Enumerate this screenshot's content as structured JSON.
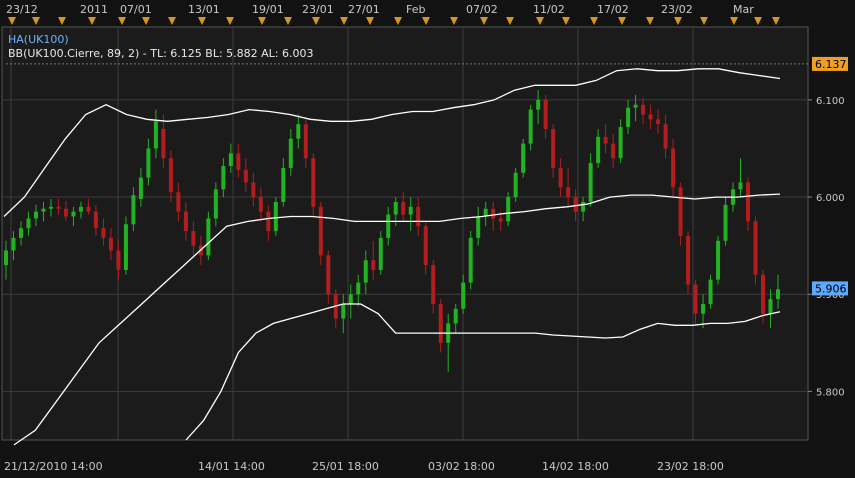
{
  "chart_data": {
    "type": "candlestick",
    "legend": {
      "symbol_line": "HA(UK100)",
      "indicator_line": "BB(UK100.Cierre, 89, 2) -  TL: 6.125  BL: 5.882  AL: 6.003"
    },
    "y_axis": {
      "range": [
        5.75,
        6.175
      ],
      "ticks": [
        "6.100",
        "6.000",
        "5.900",
        "5.800"
      ],
      "tick_values": [
        6.1,
        6.0,
        5.9,
        5.8
      ],
      "current_price_label": "5.906",
      "current_price": 5.906,
      "upper_band_label": "6.137",
      "upper_band": 6.137
    },
    "top_axis_labels": [
      "23/12",
      "2011",
      "07/01",
      "13/01",
      "19/01",
      "23/01",
      "27/01",
      "Feb",
      "07/02",
      "11/02",
      "17/02",
      "23/02",
      "Mar"
    ],
    "bottom_axis_labels": [
      "21/12/2010 14:00",
      "14/01 14:00",
      "25/01 18:00",
      "03/02 18:00",
      "14/02 18:00",
      "23/02 18:00"
    ],
    "series": [
      {
        "name": "HA(UK100)",
        "bars": [
          [
            5.93,
            5.955,
            5.915,
            5.945
          ],
          [
            5.945,
            5.965,
            5.935,
            5.958
          ],
          [
            5.958,
            5.975,
            5.95,
            5.968
          ],
          [
            5.968,
            5.985,
            5.96,
            5.978
          ],
          [
            5.978,
            5.992,
            5.97,
            5.985
          ],
          [
            5.985,
            5.995,
            5.975,
            5.988
          ],
          [
            5.988,
            5.998,
            5.98,
            5.99
          ],
          [
            5.99,
            5.998,
            5.982,
            5.988
          ],
          [
            5.988,
            5.996,
            5.975,
            5.98
          ],
          [
            5.98,
            5.99,
            5.97,
            5.985
          ],
          [
            5.985,
            5.995,
            5.978,
            5.99
          ],
          [
            5.99,
            5.998,
            5.982,
            5.985
          ],
          [
            5.985,
            5.992,
            5.96,
            5.968
          ],
          [
            5.968,
            5.978,
            5.95,
            5.958
          ],
          [
            5.958,
            5.968,
            5.935,
            5.945
          ],
          [
            5.945,
            5.955,
            5.915,
            5.925
          ],
          [
            5.925,
            5.98,
            5.92,
            5.972
          ],
          [
            5.972,
            6.01,
            5.965,
            6.002
          ],
          [
            5.998,
            6.03,
            5.99,
            6.02
          ],
          [
            6.02,
            6.06,
            6.012,
            6.05
          ],
          [
            6.05,
            6.09,
            6.04,
            6.078
          ],
          [
            6.07,
            6.085,
            6.03,
            6.04
          ],
          [
            6.04,
            6.048,
            5.995,
            6.005
          ],
          [
            6.005,
            6.015,
            5.975,
            5.985
          ],
          [
            5.985,
            5.995,
            5.955,
            5.965
          ],
          [
            5.965,
            5.975,
            5.94,
            5.95
          ],
          [
            5.95,
            5.96,
            5.93,
            5.94
          ],
          [
            5.94,
            5.985,
            5.935,
            5.978
          ],
          [
            5.978,
            6.015,
            5.97,
            6.008
          ],
          [
            6.008,
            6.04,
            6.0,
            6.032
          ],
          [
            6.032,
            6.055,
            6.025,
            6.045
          ],
          [
            6.045,
            6.055,
            6.02,
            6.028
          ],
          [
            6.028,
            6.04,
            6.005,
            6.015
          ],
          [
            6.015,
            6.025,
            5.99,
            6.0
          ],
          [
            6.0,
            6.01,
            5.975,
            5.985
          ],
          [
            5.985,
            5.992,
            5.955,
            5.965
          ],
          [
            5.965,
            6.0,
            5.96,
            5.995
          ],
          [
            5.995,
            6.04,
            5.99,
            6.03
          ],
          [
            6.03,
            6.07,
            6.022,
            6.06
          ],
          [
            6.06,
            6.085,
            6.05,
            6.075
          ],
          [
            6.075,
            6.08,
            6.03,
            6.04
          ],
          [
            6.04,
            6.045,
            5.98,
            5.99
          ],
          [
            5.99,
            5.995,
            5.93,
            5.94
          ],
          [
            5.94,
            5.945,
            5.89,
            5.9
          ],
          [
            5.9,
            5.905,
            5.865,
            5.875
          ],
          [
            5.875,
            5.9,
            5.86,
            5.89
          ],
          [
            5.89,
            5.91,
            5.875,
            5.9
          ],
          [
            5.9,
            5.92,
            5.888,
            5.912
          ],
          [
            5.912,
            5.945,
            5.9,
            5.935
          ],
          [
            5.935,
            5.955,
            5.915,
            5.925
          ],
          [
            5.925,
            5.965,
            5.92,
            5.958
          ],
          [
            5.958,
            5.99,
            5.95,
            5.982
          ],
          [
            5.982,
            6.0,
            5.97,
            5.995
          ],
          [
            5.995,
            6.005,
            5.975,
            5.982
          ],
          [
            5.982,
            6.0,
            5.965,
            5.99
          ],
          [
            5.99,
            6.0,
            5.96,
            5.97
          ],
          [
            5.97,
            5.975,
            5.92,
            5.93
          ],
          [
            5.93,
            5.935,
            5.88,
            5.89
          ],
          [
            5.89,
            5.895,
            5.84,
            5.85
          ],
          [
            5.85,
            5.88,
            5.82,
            5.87
          ],
          [
            5.87,
            5.89,
            5.86,
            5.885
          ],
          [
            5.885,
            5.92,
            5.88,
            5.912
          ],
          [
            5.912,
            5.965,
            5.905,
            5.958
          ],
          [
            5.958,
            5.99,
            5.95,
            5.98
          ],
          [
            5.98,
            5.995,
            5.97,
            5.988
          ],
          [
            5.988,
            5.995,
            5.965,
            5.978
          ],
          [
            5.978,
            5.985,
            5.965,
            5.975
          ],
          [
            5.975,
            6.005,
            5.97,
            6.0
          ],
          [
            6.0,
            6.03,
            5.995,
            6.025
          ],
          [
            6.025,
            6.06,
            6.02,
            6.055
          ],
          [
            6.055,
            6.095,
            6.048,
            6.09
          ],
          [
            6.09,
            6.11,
            6.075,
            6.1
          ],
          [
            6.1,
            6.105,
            6.06,
            6.07
          ],
          [
            6.07,
            6.075,
            6.02,
            6.03
          ],
          [
            6.03,
            6.04,
            6.0,
            6.01
          ],
          [
            6.01,
            6.03,
            5.99,
            6.0
          ],
          [
            6.0,
            6.008,
            5.975,
            5.985
          ],
          [
            5.985,
            6.0,
            5.975,
            5.995
          ],
          [
            5.995,
            6.045,
            5.99,
            6.035
          ],
          [
            6.035,
            6.07,
            6.03,
            6.062
          ],
          [
            6.062,
            6.075,
            6.045,
            6.055
          ],
          [
            6.055,
            6.065,
            6.03,
            6.04
          ],
          [
            6.04,
            6.08,
            6.035,
            6.072
          ],
          [
            6.072,
            6.1,
            6.065,
            6.092
          ],
          [
            6.092,
            6.105,
            6.078,
            6.095
          ],
          [
            6.095,
            6.102,
            6.075,
            6.085
          ],
          [
            6.085,
            6.095,
            6.07,
            6.08
          ],
          [
            6.08,
            6.09,
            6.065,
            6.075
          ],
          [
            6.075,
            6.085,
            6.04,
            6.05
          ],
          [
            6.05,
            6.06,
            6.0,
            6.01
          ],
          [
            6.01,
            6.015,
            5.95,
            5.96
          ],
          [
            5.96,
            5.965,
            5.9,
            5.91
          ],
          [
            5.91,
            5.915,
            5.87,
            5.88
          ],
          [
            5.88,
            5.9,
            5.865,
            5.89
          ],
          [
            5.89,
            5.92,
            5.885,
            5.915
          ],
          [
            5.915,
            5.96,
            5.91,
            5.955
          ],
          [
            5.955,
            6.0,
            5.95,
            5.992
          ],
          [
            5.992,
            6.015,
            5.985,
            6.008
          ],
          [
            6.008,
            6.04,
            6.0,
            6.015
          ],
          [
            6.015,
            6.02,
            5.965,
            5.975
          ],
          [
            5.975,
            5.98,
            5.91,
            5.92
          ],
          [
            5.92,
            5.925,
            5.87,
            5.88
          ],
          [
            5.88,
            5.905,
            5.865,
            5.895
          ],
          [
            5.895,
            5.92,
            5.885,
            5.905
          ]
        ]
      },
      {
        "name": "upper band",
        "values": [
          5.98,
          6.0,
          6.03,
          6.06,
          6.085,
          6.095,
          6.085,
          6.08,
          6.078,
          6.08,
          6.082,
          6.085,
          6.09,
          6.088,
          6.085,
          6.08,
          6.078,
          6.078,
          6.08,
          6.085,
          6.088,
          6.088,
          6.092,
          6.095,
          6.1,
          6.11,
          6.115,
          6.115,
          6.115,
          6.12,
          6.13,
          6.132,
          6.13,
          6.13,
          6.132,
          6.132,
          6.128,
          6.125,
          6.122
        ]
      },
      {
        "name": "middle band",
        "values": [
          5.745,
          5.76,
          5.79,
          5.82,
          5.85,
          5.87,
          5.89,
          5.91,
          5.93,
          5.95,
          5.97,
          5.975,
          5.978,
          5.98,
          5.98,
          5.978,
          5.975,
          5.975,
          5.975,
          5.975,
          5.975,
          5.978,
          5.98,
          5.983,
          5.985,
          5.988,
          5.99,
          5.993,
          6.0,
          6.002,
          6.002,
          6.0,
          5.998,
          6.0,
          6.0,
          6.002,
          6.003
        ]
      },
      {
        "name": "lower band",
        "values": [
          5.75,
          5.77,
          5.8,
          5.84,
          5.86,
          5.87,
          5.875,
          5.88,
          5.885,
          5.89,
          5.89,
          5.88,
          5.86,
          5.86,
          5.86,
          5.86,
          5.86,
          5.86,
          5.86,
          5.86,
          5.86,
          5.858,
          5.857,
          5.856,
          5.855,
          5.856,
          5.864,
          5.87,
          5.868,
          5.868,
          5.87,
          5.87,
          5.872,
          5.878,
          5.882
        ]
      }
    ],
    "colors": {
      "background": "#1b1b1b",
      "grid": "#3c3c3c",
      "up": "#22b222",
      "down": "#b31d1d",
      "bands": "#ffffff",
      "price_label_bg": "#5fa8ff",
      "band_label_bg": "#f0a020",
      "marker": "#d39a1a"
    },
    "grid": true
  }
}
